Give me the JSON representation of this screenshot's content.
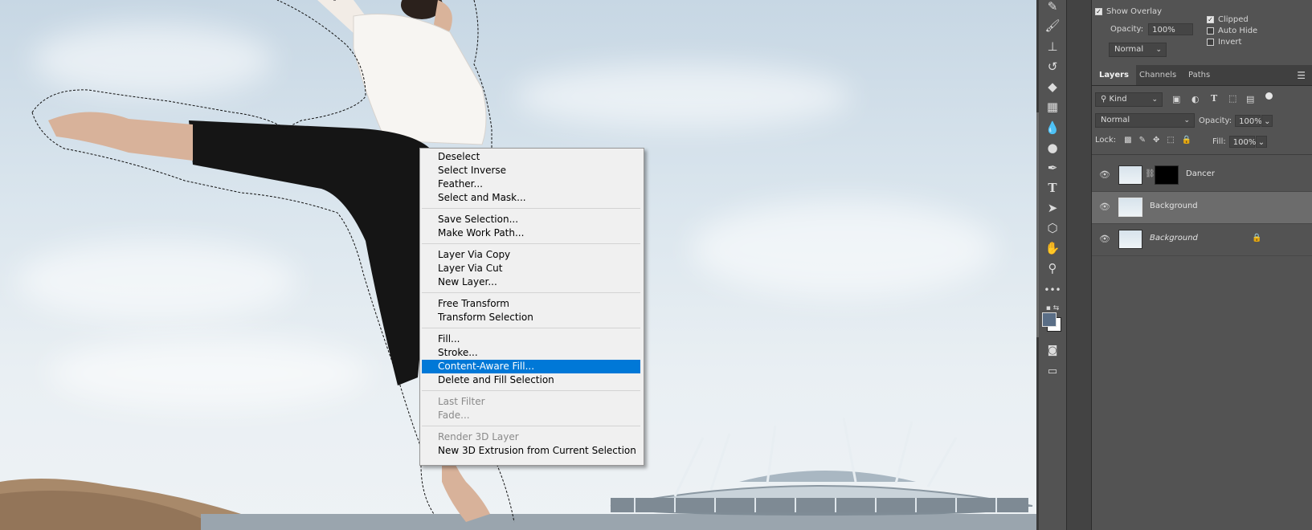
{
  "context_menu": {
    "items": [
      {
        "label": "Deselect",
        "enabled": true
      },
      {
        "label": "Select Inverse",
        "enabled": true
      },
      {
        "label": "Feather...",
        "enabled": true
      },
      {
        "label": "Select and Mask...",
        "enabled": true
      },
      {
        "label": "Save Selection...",
        "enabled": true
      },
      {
        "label": "Make Work Path...",
        "enabled": true
      },
      {
        "label": "Layer Via Copy",
        "enabled": true
      },
      {
        "label": "Layer Via Cut",
        "enabled": true
      },
      {
        "label": "New Layer...",
        "enabled": true
      },
      {
        "label": "Free Transform",
        "enabled": true
      },
      {
        "label": "Transform Selection",
        "enabled": true
      },
      {
        "label": "Fill...",
        "enabled": true
      },
      {
        "label": "Stroke...",
        "enabled": true
      },
      {
        "label": "Content-Aware Fill...",
        "enabled": true,
        "highlighted": true
      },
      {
        "label": "Delete and Fill Selection",
        "enabled": true
      },
      {
        "label": "Last Filter",
        "enabled": false
      },
      {
        "label": "Fade...",
        "enabled": false
      },
      {
        "label": "Render 3D Layer",
        "enabled": false
      },
      {
        "label": "New 3D Extrusion from Current Selection",
        "enabled": true
      }
    ]
  },
  "mask_options": {
    "show_overlay_label": "Show Overlay",
    "show_overlay_checked": true,
    "opacity_label": "Opacity:",
    "opacity_value": "100%",
    "blend_mode": "Normal",
    "clipped_label": "Clipped",
    "clipped_checked": true,
    "auto_hide_label": "Auto Hide",
    "auto_hide_checked": false,
    "invert_label": "Invert",
    "invert_checked": false
  },
  "layers_panel": {
    "tabs": [
      "Layers",
      "Channels",
      "Paths"
    ],
    "active_tab": "Layers",
    "filter_kind": "Kind",
    "blend_mode": "Normal",
    "opacity_label": "Opacity:",
    "opacity_value": "100%",
    "lock_label": "Lock:",
    "fill_label": "Fill:",
    "fill_value": "100%",
    "layers": [
      {
        "name": "Dancer",
        "visible": true,
        "has_mask": true,
        "selected": false,
        "locked": false
      },
      {
        "name": "Background",
        "visible": true,
        "has_mask": false,
        "selected": true,
        "locked": false
      },
      {
        "name": "Background",
        "visible": true,
        "has_mask": false,
        "selected": false,
        "locked": true
      }
    ]
  },
  "colors": {
    "menu_highlight": "#0078d7",
    "foreground_swatch": "#5a6e86",
    "background_swatch": "#ffffff"
  }
}
